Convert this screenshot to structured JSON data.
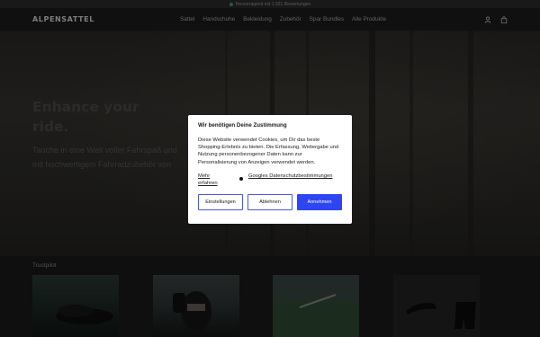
{
  "announcement": {
    "text": "Hervorragend mit 1.921 Bewertungen"
  },
  "header": {
    "logo": "ALPENSATTEL",
    "nav": [
      "Sattel",
      "Handschuhe",
      "Bekleidung",
      "Zubehör",
      "Spar Bundles",
      "Alle Produkte"
    ],
    "icons": [
      "user-icon",
      "cart-icon"
    ]
  },
  "hero": {
    "title_line1": "Enhance your",
    "title_line2": "ride.",
    "subtitle_line1": "Tauche in eine Welt voller Fahrspaß und",
    "subtitle_line2": "mit hochwertigem Fahrradzubehör von"
  },
  "section": {
    "trustpilot_label": "Trustpilot"
  },
  "consent": {
    "title": "Wir benötigen Deine Zustimmung",
    "text": "Diese Website verwendet Cookies, um Dir das beste Shopping-Erlebnis zu bieten. Die Erfassung, Weitergabe und Nutzung personenbezogener Daten kann zur Personalisierung von Anzeigen verwendet werden.",
    "link_more": "Mehr erfahren",
    "link_google": "Googles Datenschutzbestimmungen",
    "btn_settings": "Einstellungen",
    "btn_decline": "Ablehnen",
    "btn_accept": "Annehmen"
  },
  "colors": {
    "accent": "#2d46f2",
    "status_green": "#3aa05a"
  }
}
